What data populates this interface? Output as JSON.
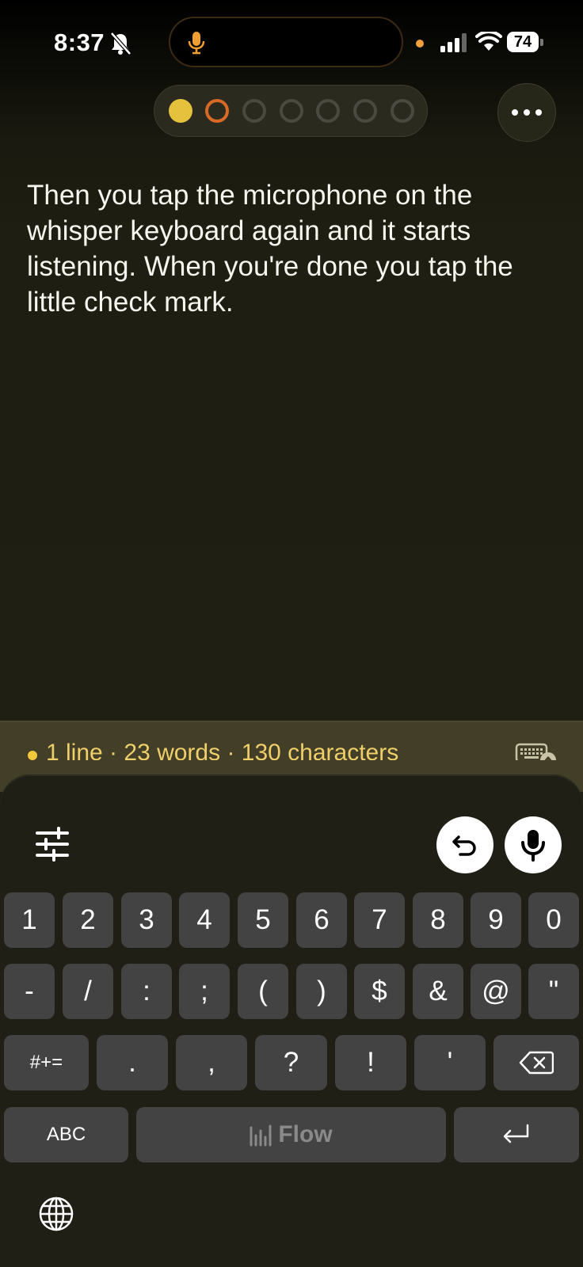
{
  "status_bar": {
    "time": "8:37",
    "battery": "74"
  },
  "pager": {
    "dots": [
      "filled",
      "active",
      "empty",
      "empty",
      "empty",
      "empty",
      "empty"
    ]
  },
  "document": {
    "text": "Then you tap the microphone on the whisper keyboard again and it starts listening. When you're done you tap the little check mark."
  },
  "stats": {
    "text": "1 line · 23 words · 130 characters"
  },
  "keyboard": {
    "row1": [
      "1",
      "2",
      "3",
      "4",
      "5",
      "6",
      "7",
      "8",
      "9",
      "0"
    ],
    "row2": [
      "-",
      "/",
      ":",
      ";",
      "(",
      ")",
      "$",
      "&",
      "@",
      "\""
    ],
    "row3": [
      "#+=",
      ".",
      ",",
      "?",
      "!",
      "'"
    ],
    "abc_label": "ABC",
    "space_label": "Flow"
  },
  "colors": {
    "accent_yellow": "#e6c13e",
    "accent_orange": "#d86a26",
    "stats_text": "#efcf6a"
  }
}
